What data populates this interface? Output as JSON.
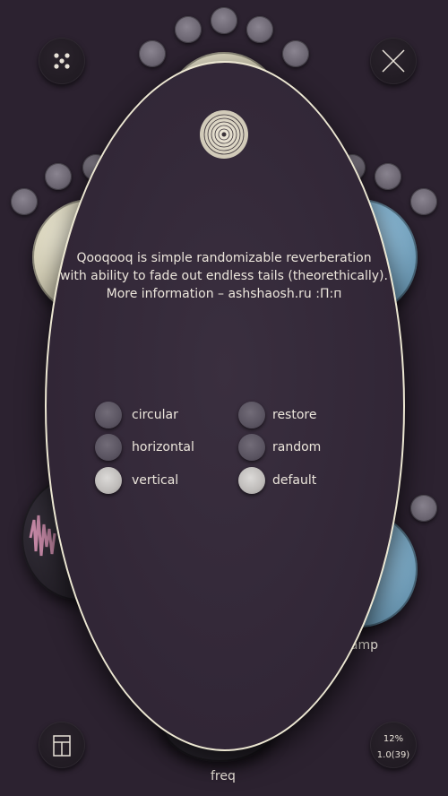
{
  "info": {
    "line1": "Qooqooq is simple randomizable reverberation",
    "line2": "with ability to fade out endless tails (theorethically).",
    "line3": "More information – ashshaosh.ru      :П:п"
  },
  "options": {
    "left": [
      {
        "label": "circular",
        "active": false
      },
      {
        "label": "horizontal",
        "active": false
      },
      {
        "label": "vertical",
        "active": true
      }
    ],
    "right": [
      {
        "label": "restore",
        "active": false
      },
      {
        "label": "random",
        "active": false
      },
      {
        "label": "default",
        "active": true
      }
    ]
  },
  "labels": {
    "freq": "freq",
    "damp": "damp"
  },
  "status": {
    "percent": "12%",
    "version": "1.0(39)"
  },
  "icons": {
    "top_left": "dots-menu-icon",
    "top_right": "close-icon",
    "bottom_left": "layout-icon",
    "logo": "spiral-logo-icon"
  }
}
